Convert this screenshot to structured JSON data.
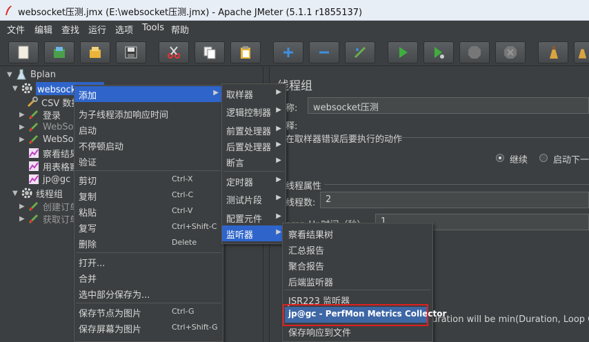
{
  "window": {
    "title": "websocket压测.jmx (E:\\websocket压测.jmx) - Apache JMeter (5.1.1 r1855137)"
  },
  "menubar": {
    "items": [
      "文件",
      "编辑",
      "查找",
      "运行",
      "选项",
      "Tools",
      "帮助"
    ]
  },
  "toolbar": {
    "buttons": [
      "new-icon",
      "templates-icon",
      "open-icon",
      "save-icon",
      "cut-icon",
      "copy-icon",
      "paste-icon",
      "expand-icon",
      "collapse-icon",
      "toggle-icon",
      "start-icon",
      "start-no-pause-icon",
      "stop-icon",
      "shutdown-icon",
      "clear-icon",
      "clear-all-icon"
    ]
  },
  "tree": {
    "nodes": [
      {
        "label": "Bplan",
        "icon": "test-plan-icon"
      },
      {
        "label": "websocket压测",
        "icon": "gear-icon"
      },
      {
        "label": "CSV 数据",
        "icon": "wrench-icon"
      },
      {
        "label": "登录",
        "icon": "sampler-icon"
      },
      {
        "label": "WebSoc",
        "icon": "sampler-icon"
      },
      {
        "label": "WebSoc",
        "icon": "sampler-icon"
      },
      {
        "label": "察看结果",
        "icon": "chart-icon"
      },
      {
        "label": "用表格察",
        "icon": "chart-icon"
      },
      {
        "label": "jp@gc -",
        "icon": "chart-icon"
      },
      {
        "label": "线程组",
        "icon": "gear-icon"
      },
      {
        "label": "创建订单",
        "icon": "sampler-icon"
      },
      {
        "label": "获取订单",
        "icon": "sampler-icon"
      }
    ]
  },
  "panel": {
    "title": "线程组",
    "name_label": "称:",
    "name_value": "websocket压测",
    "comment_label": "释:",
    "on_error_label": "在取样器错误后要执行的动作",
    "continue_label": "继续",
    "next_loop_label": "启动下一",
    "thread_props_label": "线程属性",
    "threads_label": "线程数:",
    "threads_value": "2",
    "rampup_label": "amp-Up时间（秒）:",
    "rampup_value": "1",
    "duration_text": "uration will be min(Duration, Loop Count"
  },
  "context_menu": {
    "items": [
      {
        "label": "添加",
        "submenu": true
      },
      {
        "label": "为子线程添加响应时间"
      },
      {
        "label": "启动"
      },
      {
        "label": "不停顿启动"
      },
      {
        "label": "验证"
      },
      {
        "label": "剪切",
        "shortcut": "Ctrl-X"
      },
      {
        "label": "复制",
        "shortcut": "Ctrl-C"
      },
      {
        "label": "粘贴",
        "shortcut": "Ctrl-V"
      },
      {
        "label": "复写",
        "shortcut": "Ctrl+Shift-C"
      },
      {
        "label": "删除",
        "shortcut": "Delete"
      },
      {
        "label": "打开..."
      },
      {
        "label": "合并"
      },
      {
        "label": "选中部分保存为..."
      },
      {
        "label": "保存节点为图片",
        "shortcut": "Ctrl-G"
      },
      {
        "label": "保存屏幕为图片",
        "shortcut": "Ctrl+Shift-G"
      }
    ]
  },
  "add_submenu": {
    "items": [
      "取样器",
      "逻辑控制器",
      "前置处理器",
      "后置处理器",
      "断言",
      "定时器",
      "测试片段",
      "配置元件",
      "监听器"
    ]
  },
  "listener_submenu": {
    "items": [
      "察看结果树",
      "汇总报告",
      "聚合报告",
      "后端监听器",
      "JSR223 监听器",
      "jp@gc - PerfMon Metrics Collector",
      "保存响应到文件"
    ]
  },
  "colors": {
    "selection": "#2f65ca",
    "highlight_box": "#e02020",
    "background": "#3c3f41"
  }
}
